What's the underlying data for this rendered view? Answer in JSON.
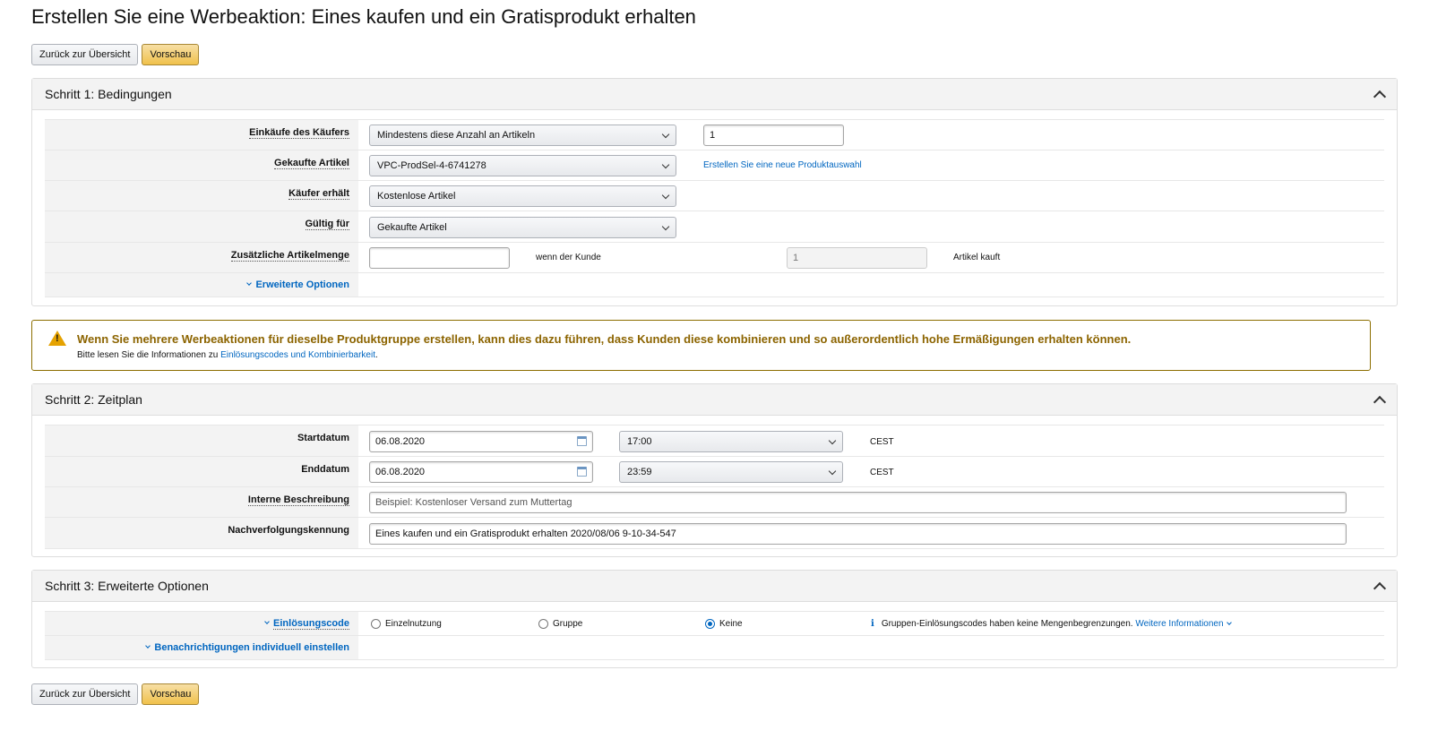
{
  "page": {
    "title": "Erstellen Sie eine Werbeaktion: Eines kaufen und ein Gratisprodukt erhalten",
    "back_label": "Zurück zur Übersicht",
    "preview_label": "Vorschau"
  },
  "step1": {
    "title": "Schritt 1: Bedingungen",
    "purchase_label": "Einkäufe des Käufers",
    "purchase_select": "Mindestens diese Anzahl an Artikeln",
    "purchase_qty": "1",
    "items_label": "Gekaufte Artikel",
    "items_select": "VPC-ProdSel-4-6741278",
    "items_link": "Erstellen Sie eine neue Produktauswahl",
    "receives_label": "Käufer erhält",
    "receives_select": "Kostenlose Artikel",
    "valid_label": "Gültig für",
    "valid_select": "Gekaufte Artikel",
    "extra_label": "Zusätzliche Artikelmenge",
    "extra_value": "",
    "when_text": "wenn der Kunde",
    "buys_qty": "1",
    "buys_text": "Artikel kauft",
    "advanced_label": "Erweiterte Optionen"
  },
  "alert": {
    "icon": "warning-icon",
    "headline": "Wenn Sie mehrere Werbeaktionen für dieselbe Produktgruppe erstellen, kann dies dazu führen, dass Kunden diese kombinieren und so außerordentlich hohe Ermäßigungen erhalten können.",
    "text_prefix": "Bitte lesen Sie die Informationen zu",
    "link": "Einlösungscodes und Kombinierbarkeit",
    "text_suffix": "."
  },
  "step2": {
    "title": "Schritt 2: Zeitplan",
    "start_label": "Startdatum",
    "start_date": "06.08.2020",
    "start_time": "17:00",
    "start_tz": "CEST",
    "end_label": "Enddatum",
    "end_date": "06.08.2020",
    "end_time": "23:59",
    "end_tz": "CEST",
    "desc_label": "Interne Beschreibung",
    "desc_placeholder": "Beispiel: Kostenloser Versand zum Muttertag",
    "tracking_label": "Nachverfolgungskennung",
    "tracking_value": "Eines kaufen und ein Gratisprodukt erhalten 2020/08/06 9-10-34-547"
  },
  "step3": {
    "title": "Schritt 3: Erweiterte Optionen",
    "code_label": "Einlösungscode",
    "radio_single": "Einzelnutzung",
    "radio_group": "Gruppe",
    "radio_none": "Keine",
    "selected": "Keine",
    "info_text": "Gruppen-Einlösungscodes haben keine Mengenbegrenzungen.",
    "info_link": "Weitere Informationen",
    "notify_label": "Benachrichtigungen individuell einstellen"
  },
  "colors": {
    "accent": "#f0c14b",
    "link": "#0066c0",
    "warning_border": "#8c6e00"
  }
}
